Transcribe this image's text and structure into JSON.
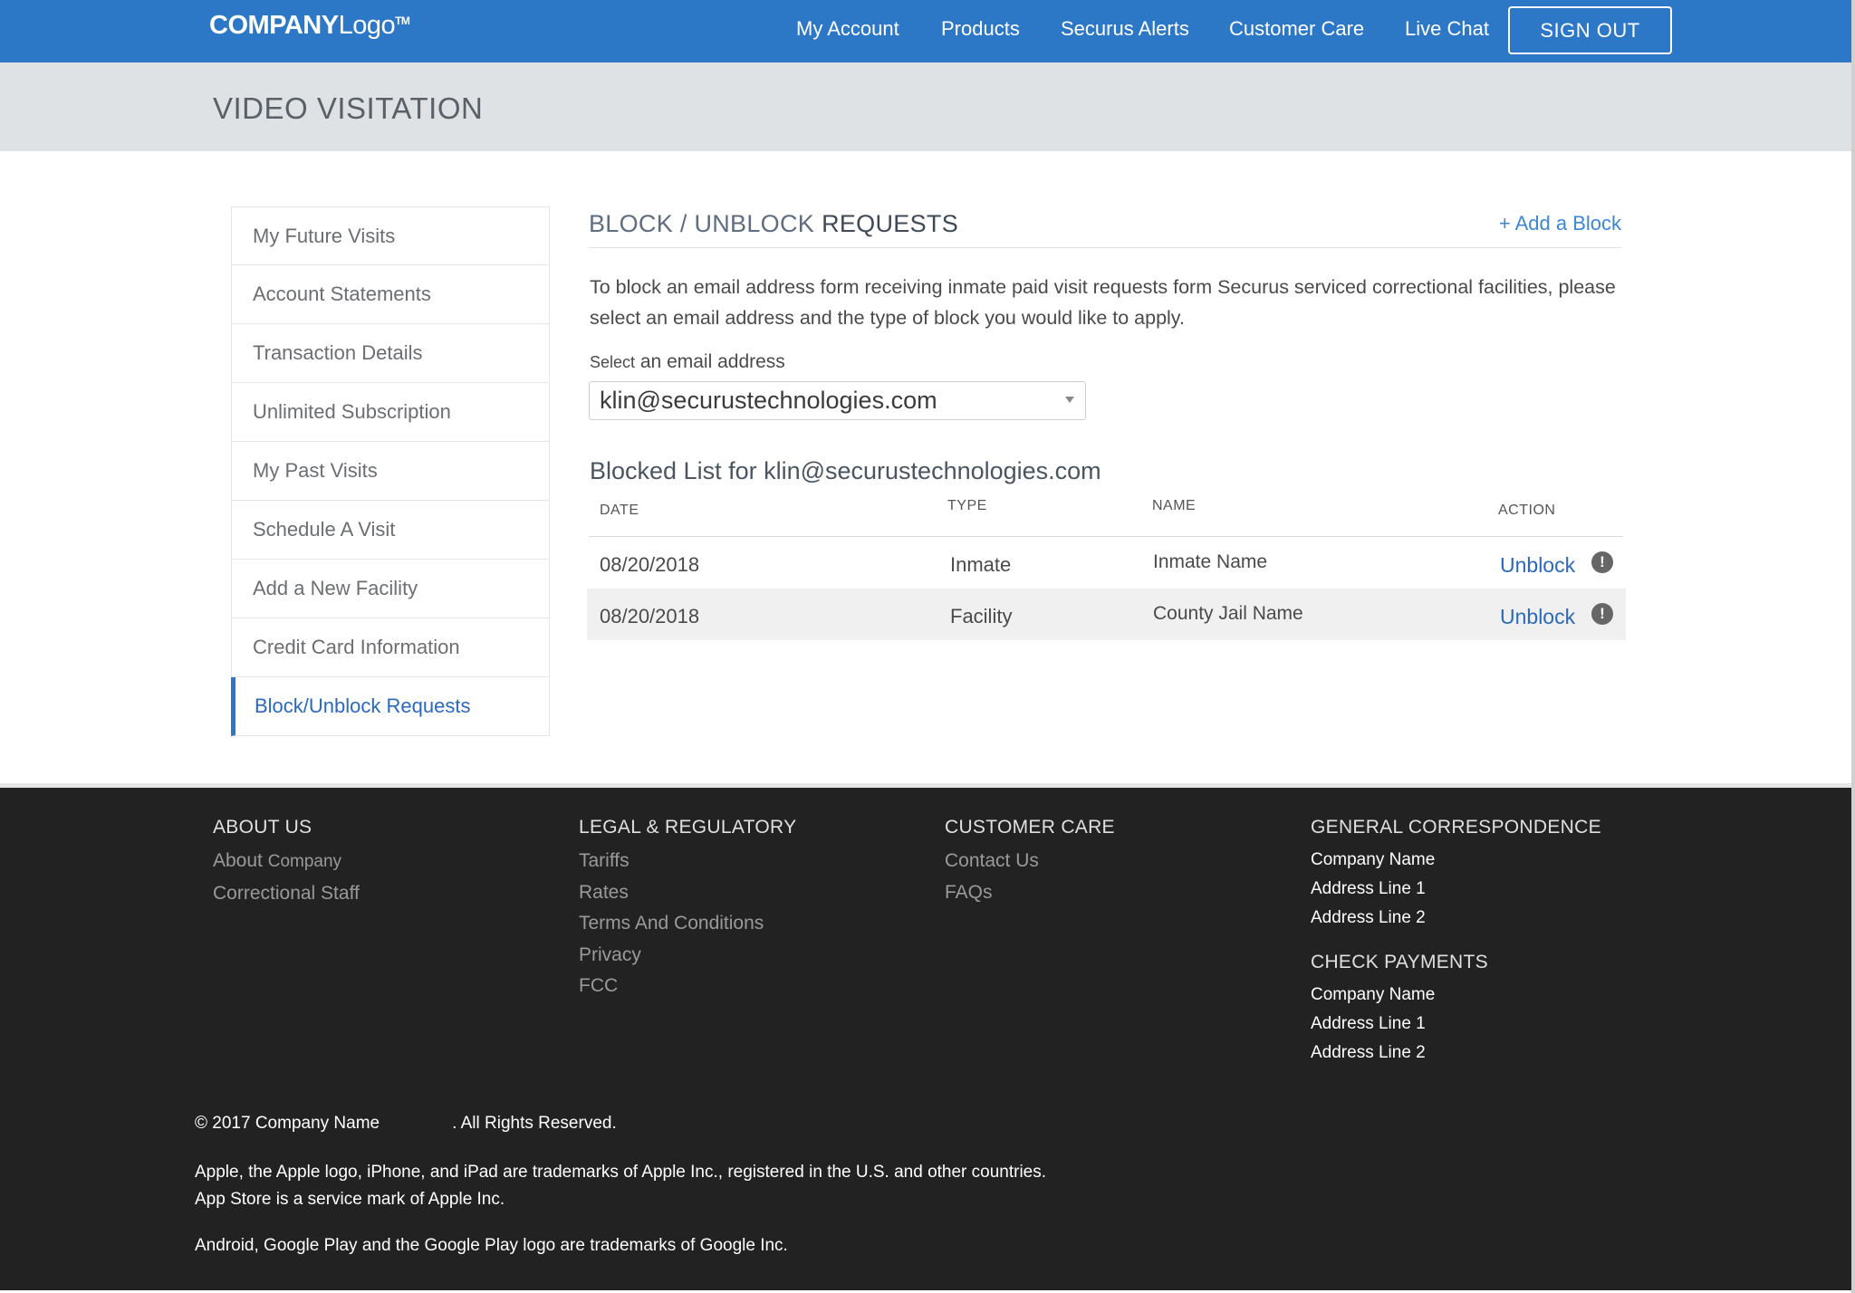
{
  "header": {
    "logo_bold": "COMPANY",
    "logo_light": "Logo",
    "logo_tm": "TM",
    "nav": [
      "My Account",
      "Products",
      "Securus Alerts",
      "Customer Care",
      "Live Chat"
    ],
    "sign_out": "SIGN OUT",
    "colors": {
      "bar": "#2d77c7",
      "accent_link": "#2a69bd"
    }
  },
  "page_title": "VIDEO VISITATION",
  "sidebar": {
    "items": [
      "My Future Visits",
      "Account Statements",
      "Transaction Details",
      "Unlimited Subscription",
      "My Past Visits",
      "Schedule A Visit",
      "Add a New Facility",
      "Credit Card Information",
      "Block/Unblock Requests"
    ],
    "active": "Block/Unblock Requests"
  },
  "main": {
    "title_light": "BLOCK / UNBLOCK",
    "title_dark": "REQUESTS",
    "add_block": "+ Add a Block",
    "intro": "To block an email address form receiving inmate paid visit requests form Securus serviced correctional facilities, please select an email address and the type of block you would like to apply.",
    "select_label_small": "Select",
    "select_label_rest": "an email address",
    "selected_email": "klin@securustechnologies.com",
    "list_title": "Blocked List for klin@securustechnologies.com",
    "columns": [
      "DATE",
      "TYPE",
      "NAME",
      "ACTION"
    ],
    "rows": [
      {
        "date": "08/20/2018",
        "type": "Inmate",
        "name": "Inmate Name",
        "action": "Unblock",
        "icon": "alert-icon"
      },
      {
        "date": "08/20/2018",
        "type": "Facility",
        "name": "County Jail Name",
        "action": "Unblock",
        "icon": "alert-icon"
      }
    ]
  },
  "footer": {
    "about": {
      "heading": "ABOUT US",
      "links": [
        "About",
        "Company",
        "Correctional Staff"
      ]
    },
    "legal": {
      "heading": "LEGAL & REGULATORY",
      "links": [
        "Tariffs",
        "Rates",
        "Terms And Conditions",
        "Privacy",
        "FCC"
      ]
    },
    "care": {
      "heading": "CUSTOMER CARE",
      "links": [
        "Contact Us",
        "FAQs"
      ]
    },
    "correspondence": {
      "heading": "GENERAL CORRESPONDENCE",
      "lines": [
        "Company Name",
        "Address Line 1",
        "Address Line 2"
      ]
    },
    "payments": {
      "heading": "CHECK PAYMENTS",
      "lines": [
        "Company Name",
        "Address Line 1",
        "Address Line 2"
      ]
    },
    "copyright_prefix": "© 2017",
    "copyright_company": "Company Name",
    "copyright_suffix": ". All Rights Reserved.",
    "apple_line1": "Apple, the Apple logo, iPhone, and iPad are trademarks of Apple Inc., registered in the U.S. and other countries.",
    "apple_line2": "App Store is a service mark of Apple Inc.",
    "android_line": "Android, Google Play and the Google Play logo are trademarks of Google Inc."
  }
}
